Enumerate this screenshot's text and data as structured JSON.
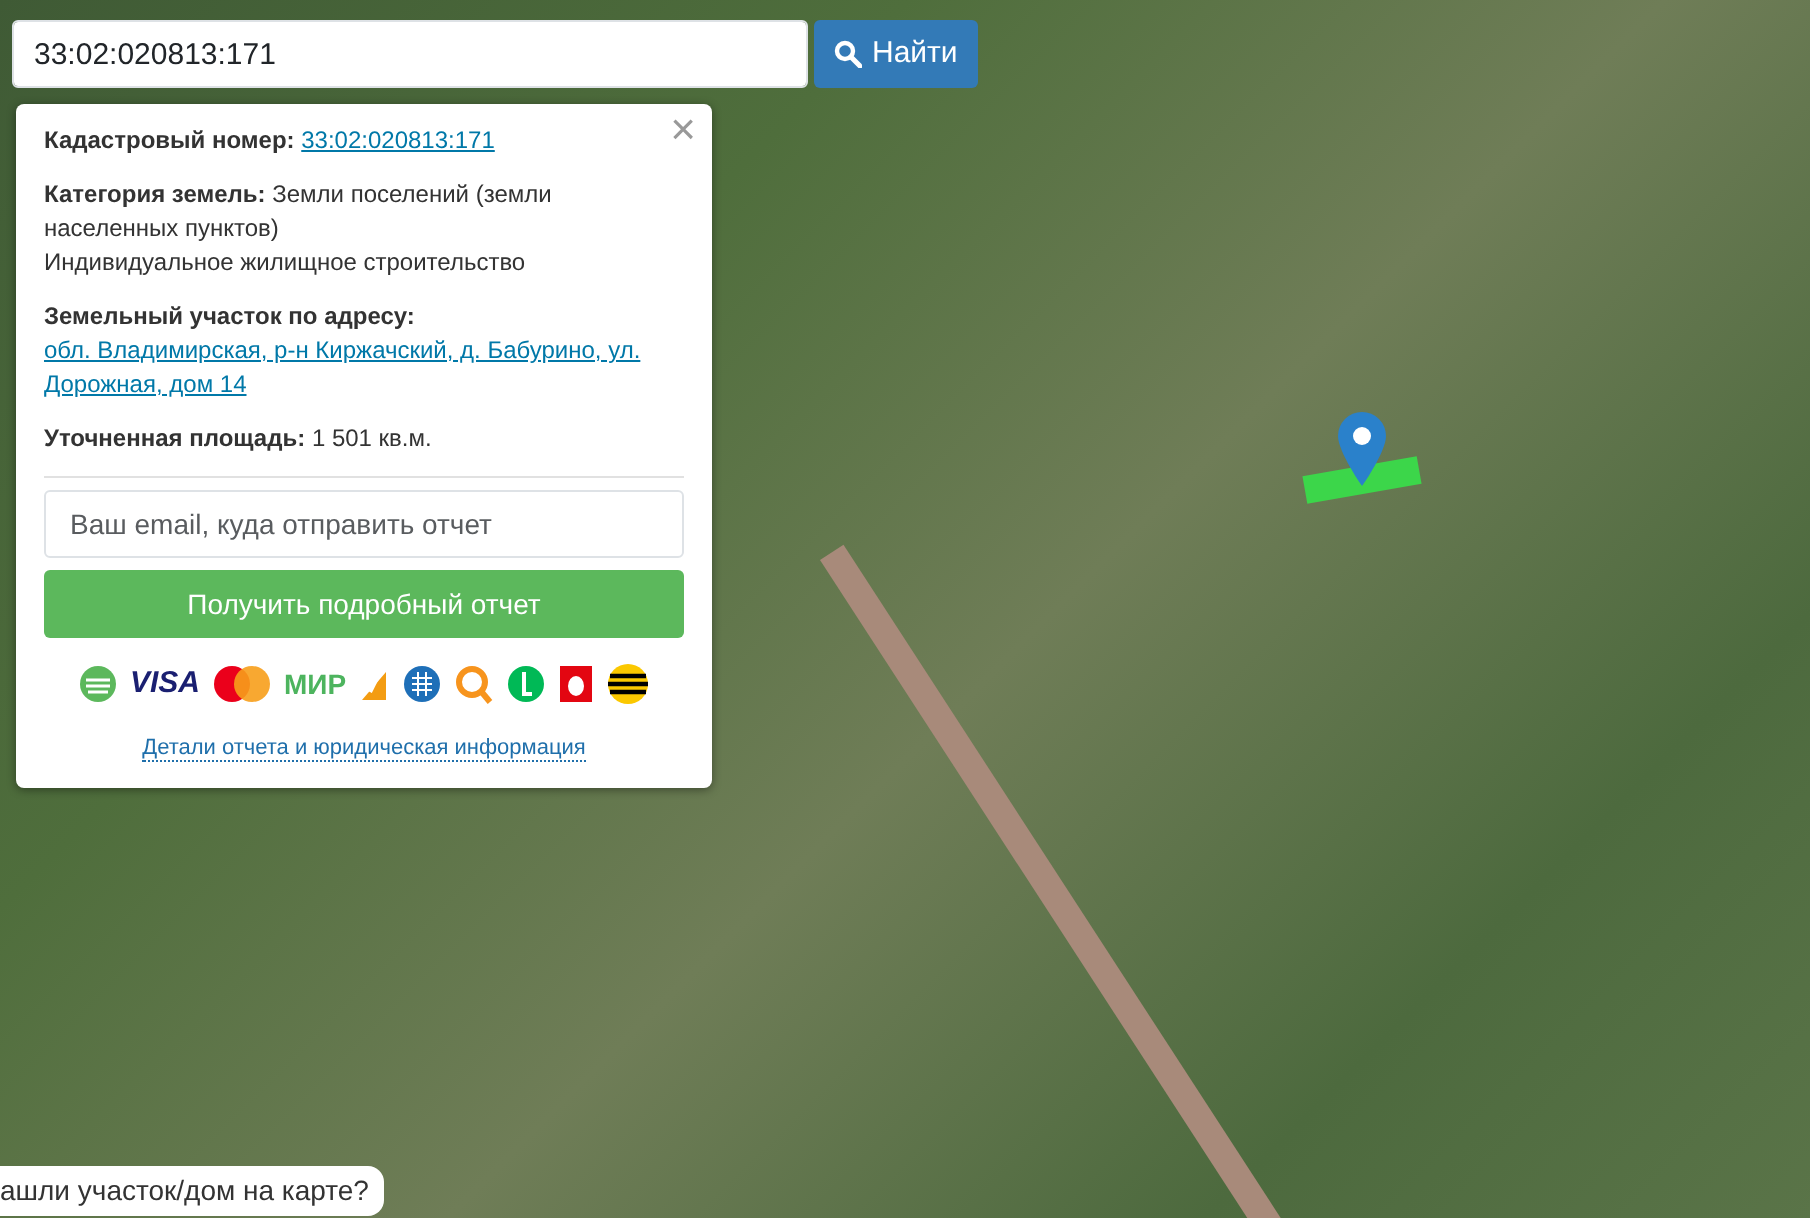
{
  "search": {
    "value": "33:02:020813:171",
    "button": "Найти"
  },
  "popup": {
    "close": "×",
    "fields": [
      {
        "label": "Кадастровый номер:",
        "value": "33:02:020813:171",
        "kind": "link"
      },
      {
        "label": "Категория земель:",
        "value": "Земли поселений (земли населенных пунктов)",
        "kind": "text"
      },
      {
        "value": "Индивидуальное жилищное строительство",
        "kind": "plain"
      },
      {
        "label": "Земельный участок по адресу:",
        "value": "обл. Владимирская, р-н Киржачский, д. Бабурино, ул. Дорожная, дом 14",
        "kind": "link"
      },
      {
        "label": "Уточненная площадь:",
        "value": "1 501 кв.м.",
        "kind": "text"
      }
    ],
    "email": {
      "placeholder": "Ваш email, куда отправить отчет"
    },
    "submit": "Получить подробный отчет",
    "payments": [
      {
        "kind": "sber"
      },
      {
        "kind": "visa",
        "text": "VISA"
      },
      {
        "kind": "mastercard"
      },
      {
        "kind": "mir",
        "text": "МИР"
      },
      {
        "kind": "yandex"
      },
      {
        "kind": "webmoney"
      },
      {
        "kind": "qiwi"
      },
      {
        "kind": "megafon"
      },
      {
        "kind": "mts"
      },
      {
        "kind": "beeline"
      }
    ],
    "details_link": "Детали отчета и юридическая информация"
  },
  "help_bubble": "ашли участок/дом на карте?"
}
